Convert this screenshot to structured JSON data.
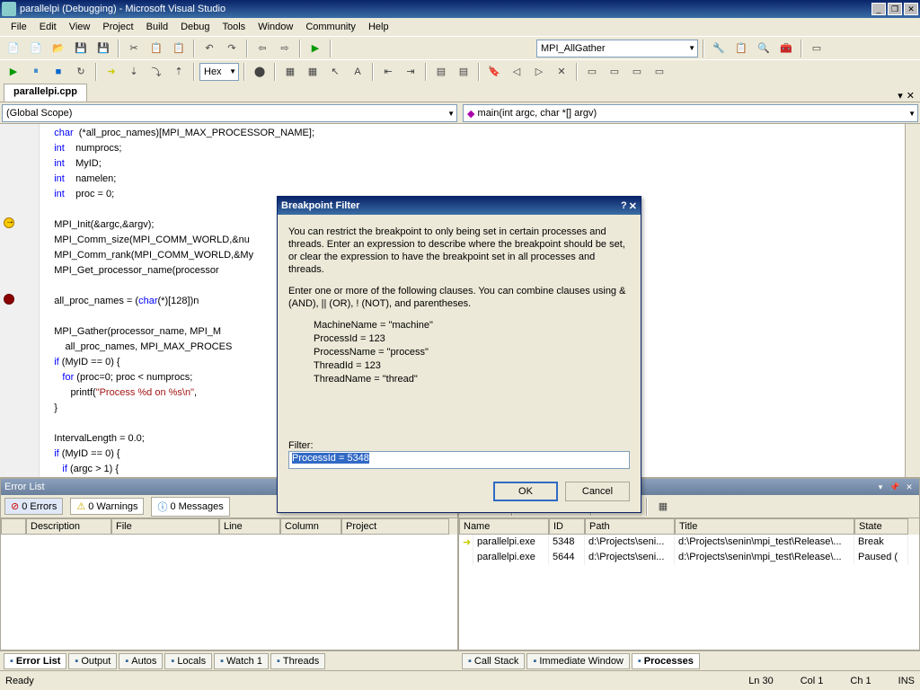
{
  "window": {
    "title": "parallelpi (Debugging) - Microsoft Visual Studio"
  },
  "menu": [
    "File",
    "Edit",
    "View",
    "Project",
    "Build",
    "Debug",
    "Tools",
    "Window",
    "Community",
    "Help"
  ],
  "toolbar2": {
    "hex": "Hex",
    "search": "MPI_AllGather"
  },
  "filetab": "parallelpi.cpp",
  "scope": {
    "left": "(Global Scope)",
    "right": "main(int argc, char *[] argv)"
  },
  "code": {
    "lines": [
      {
        "t": "    char  (*all_proc_names)[MPI_MAX_PROCESSOR_NAME];",
        "k": [
          "char"
        ]
      },
      {
        "t": "    int    numprocs;",
        "k": [
          "int"
        ]
      },
      {
        "t": "    int    MyID;",
        "k": [
          "int"
        ]
      },
      {
        "t": "    int    namelen;",
        "k": [
          "int"
        ]
      },
      {
        "t": "    int    proc = 0;",
        "k": [
          "int"
        ]
      },
      {
        "t": ""
      },
      {
        "t": "    MPI_Init(&argc,&argv);"
      },
      {
        "t": "    MPI_Comm_size(MPI_COMM_WORLD,&nu"
      },
      {
        "t": "    MPI_Comm_rank(MPI_COMM_WORLD,&My"
      },
      {
        "t": "    MPI_Get_processor_name(processor"
      },
      {
        "t": ""
      },
      {
        "t": "    all_proc_names = (char(*)[128])n",
        "k": [
          "char"
        ]
      },
      {
        "t": ""
      },
      {
        "t": "    MPI_Gather(processor_name, MPI_M"
      },
      {
        "t": "        all_proc_names, MPI_MAX_PROCES"
      },
      {
        "t": "    if (MyID == 0) {",
        "k": [
          "if"
        ]
      },
      {
        "t": "       for (proc=0; proc < numprocs; ",
        "k": [
          "for"
        ]
      },
      {
        "t": "          printf(\"Process %d on %s\\n\",",
        "s": "\"Process %d on %s\\n\""
      },
      {
        "t": "    }"
      },
      {
        "t": ""
      },
      {
        "t": "    IntervalLength = 0.0;"
      },
      {
        "t": "    if (MyID == 0) {",
        "k": [
          "if"
        ]
      },
      {
        "t": "       if (argc > 1) {",
        "k": [
          "if"
        ]
      }
    ],
    "bpCurrent": 6,
    "bpSet": 11
  },
  "dialog": {
    "title": "Breakpoint Filter",
    "p1": "You can restrict the breakpoint to only being set in certain processes and threads. Enter an expression to describe where the breakpoint should be set, or clear the expression to have the breakpoint set in all processes and threads.",
    "p2": "Enter one or more of the following clauses. You can combine clauses using & (AND), || (OR), ! (NOT), and parentheses.",
    "examples": [
      "MachineName = \"machine\"",
      "ProcessId = 123",
      "ProcessName = \"process\"",
      "ThreadId = 123",
      "ThreadName = \"thread\""
    ],
    "filterLabel": "Filter:",
    "filterValue": "ProcessId = 5348",
    "ok": "OK",
    "cancel": "Cancel"
  },
  "errorlist": {
    "title": "Error List",
    "errors": "0 Errors",
    "warnings": "0 Warnings",
    "messages": "0 Messages",
    "cols": [
      "",
      "Description",
      "File",
      "Line",
      "Column",
      "Project"
    ]
  },
  "processes": {
    "title": "Processes",
    "cols": [
      "Name",
      "ID",
      "Path",
      "Title",
      "State"
    ],
    "rows": [
      {
        "arrow": true,
        "name": "parallelpi.exe",
        "id": "5348",
        "path": "d:\\Projects\\seni...",
        "title": "d:\\Projects\\senin\\mpi_test\\Release\\...",
        "state": "Break"
      },
      {
        "arrow": false,
        "name": "parallelpi.exe",
        "id": "5644",
        "path": "d:\\Projects\\seni...",
        "title": "d:\\Projects\\senin\\mpi_test\\Release\\...",
        "state": "Paused ("
      }
    ]
  },
  "bottomtabs": {
    "left": [
      "Error List",
      "Output",
      "Autos",
      "Locals",
      "Watch 1",
      "Threads"
    ],
    "right": [
      "Call Stack",
      "Immediate Window",
      "Processes"
    ]
  },
  "status": {
    "ready": "Ready",
    "ln": "Ln 30",
    "col": "Col 1",
    "ch": "Ch 1",
    "ins": "INS"
  }
}
